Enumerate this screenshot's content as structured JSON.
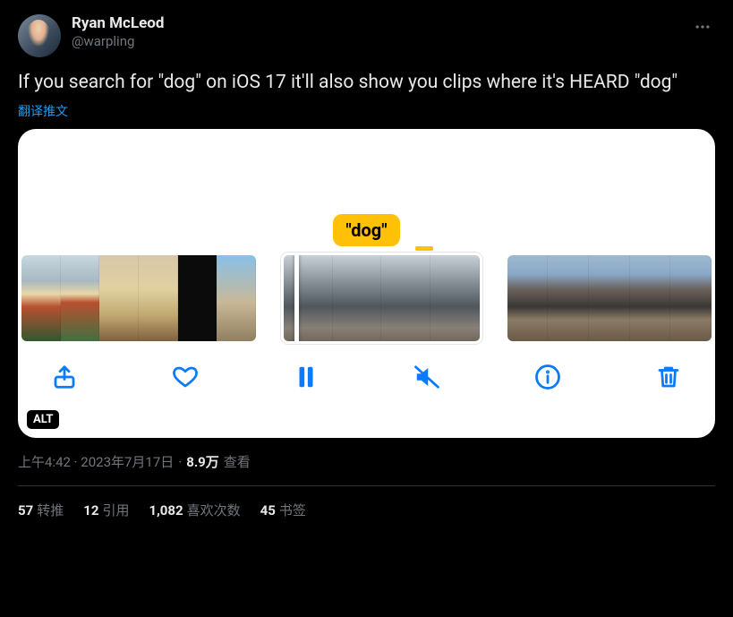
{
  "user": {
    "display_name": "Ryan McLeod",
    "handle": "@warpling"
  },
  "tweet": {
    "text": "If you search for \"dog\" on iOS 17 it'll also show you clips where it's HEARD \"dog\"",
    "translate_label": "翻译推文",
    "alt_badge": "ALT",
    "timestamp": "上午4:42 · 2023年7月17日",
    "views_count": "8.9万",
    "views_label": "查看"
  },
  "media": {
    "tag_label": "\"dog\""
  },
  "stats": {
    "retweets": {
      "count": "57",
      "label": "转推"
    },
    "quotes": {
      "count": "12",
      "label": "引用"
    },
    "likes": {
      "count": "1,082",
      "label": "喜欢次数"
    },
    "bookmarks": {
      "count": "45",
      "label": "书签"
    }
  }
}
